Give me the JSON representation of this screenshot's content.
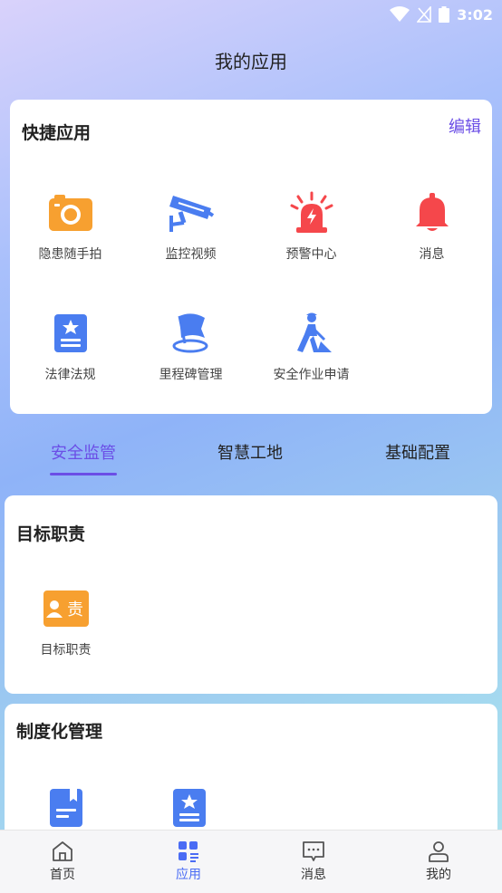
{
  "status_bar": {
    "time": "3:02"
  },
  "header": {
    "title": "我的应用"
  },
  "quick_apps": {
    "title": "快捷应用",
    "edit_label": "编辑",
    "items": [
      {
        "label": "隐患随手拍",
        "icon": "camera-icon"
      },
      {
        "label": "监控视频",
        "icon": "surveillance-camera-icon"
      },
      {
        "label": "预警中心",
        "icon": "alarm-light-icon"
      },
      {
        "label": "消息",
        "icon": "bell-icon"
      },
      {
        "label": "法律法规",
        "icon": "law-document-icon"
      },
      {
        "label": "里程碑管理",
        "icon": "milestone-flag-icon"
      },
      {
        "label": "安全作业申请",
        "icon": "worker-shovel-icon"
      }
    ]
  },
  "tabs": [
    {
      "label": "安全监管",
      "active": true
    },
    {
      "label": "智慧工地",
      "active": false
    },
    {
      "label": "基础配置",
      "active": false
    }
  ],
  "sections": [
    {
      "title": "目标职责",
      "items": [
        {
          "label": "目标职责",
          "icon": "responsibility-icon"
        }
      ]
    },
    {
      "title": "制度化管理",
      "items": [
        {
          "label": "",
          "icon": "bookmark-document-icon"
        },
        {
          "label": "",
          "icon": "star-document-icon"
        }
      ]
    }
  ],
  "bottom_nav": [
    {
      "label": "首页",
      "icon": "home-icon",
      "active": false
    },
    {
      "label": "应用",
      "icon": "apps-icon",
      "active": true
    },
    {
      "label": "消息",
      "icon": "message-icon",
      "active": false
    },
    {
      "label": "我的",
      "icon": "profile-icon",
      "active": false
    }
  ],
  "colors": {
    "accent": "#6b4ee6",
    "nav_active": "#4a6cf4",
    "blue_icon": "#4a7df0",
    "orange_icon": "#f7a030",
    "red_icon": "#f5474b"
  }
}
